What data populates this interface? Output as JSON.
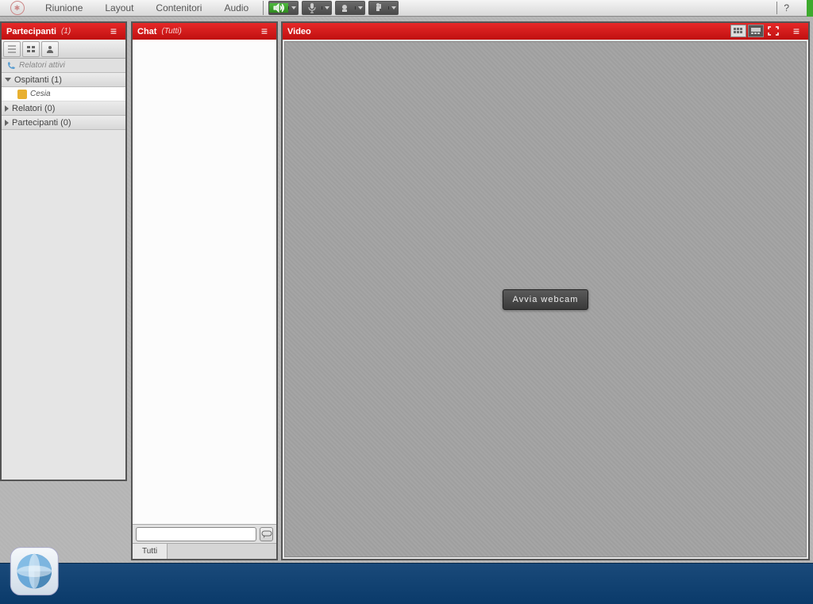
{
  "topbar": {
    "menu": [
      "Riunione",
      "Layout",
      "Contenitori",
      "Audio"
    ],
    "help": "?"
  },
  "participants": {
    "title": "Partecipanti",
    "subtitle": "(1)",
    "active_speakers": "Relatori attivi",
    "groups": [
      {
        "label": "Ospitanti (1)",
        "expanded": true,
        "users": [
          "Cesia"
        ]
      },
      {
        "label": "Relatori (0)",
        "expanded": false,
        "users": []
      },
      {
        "label": "Partecipanti (0)",
        "expanded": false,
        "users": []
      }
    ]
  },
  "chat": {
    "title": "Chat",
    "subtitle": "(Tutti)",
    "input_placeholder": "",
    "tab": "Tutti"
  },
  "video": {
    "title": "Video",
    "start_btn": "Avvia webcam"
  }
}
